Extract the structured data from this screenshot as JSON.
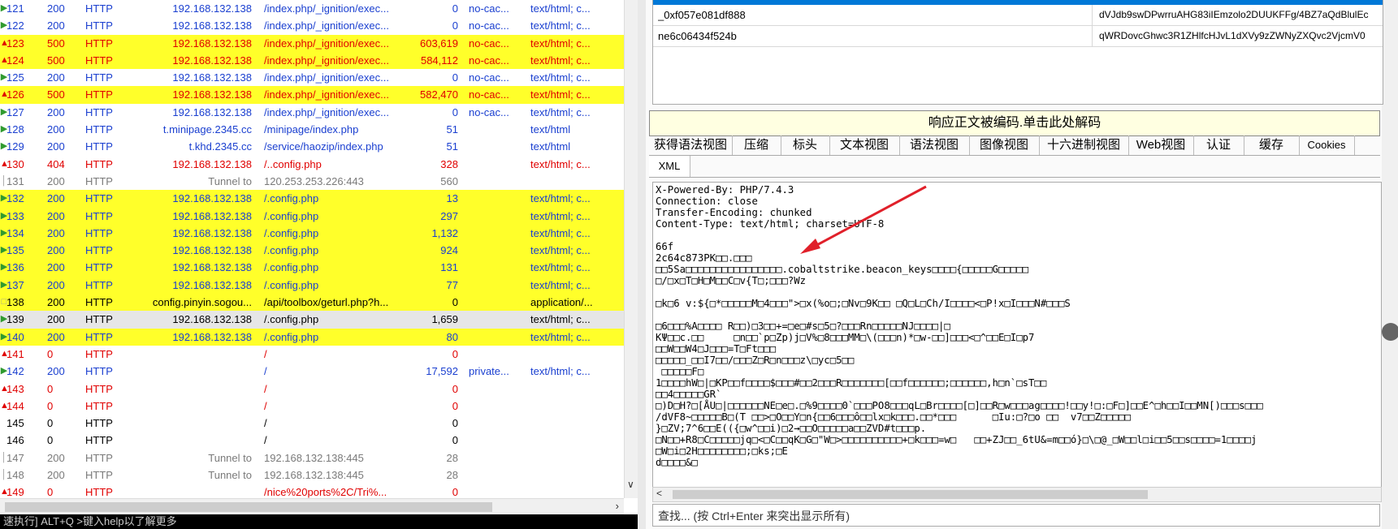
{
  "sessions": [
    {
      "num": "121",
      "result": "200",
      "protocol": "HTTP",
      "host": "192.168.132.138",
      "url": "/index.php/_ignition/exec...",
      "body": "0",
      "caching": "no-cac...",
      "ctype": "text/html; c...",
      "icon": "ok",
      "style": "ok",
      "bg": ""
    },
    {
      "num": "122",
      "result": "200",
      "protocol": "HTTP",
      "host": "192.168.132.138",
      "url": "/index.php/_ignition/exec...",
      "body": "0",
      "caching": "no-cac...",
      "ctype": "text/html; c...",
      "icon": "ok",
      "style": "ok",
      "bg": ""
    },
    {
      "num": "123",
      "result": "500",
      "protocol": "HTTP",
      "host": "192.168.132.138",
      "url": "/index.php/_ignition/exec...",
      "body": "603,619",
      "caching": "no-cac...",
      "ctype": "text/html; c...",
      "icon": "err",
      "style": "err",
      "bg": "yellow"
    },
    {
      "num": "124",
      "result": "500",
      "protocol": "HTTP",
      "host": "192.168.132.138",
      "url": "/index.php/_ignition/exec...",
      "body": "584,112",
      "caching": "no-cac...",
      "ctype": "text/html; c...",
      "icon": "err",
      "style": "err",
      "bg": "yellow"
    },
    {
      "num": "125",
      "result": "200",
      "protocol": "HTTP",
      "host": "192.168.132.138",
      "url": "/index.php/_ignition/exec...",
      "body": "0",
      "caching": "no-cac...",
      "ctype": "text/html; c...",
      "icon": "ok",
      "style": "ok",
      "bg": ""
    },
    {
      "num": "126",
      "result": "500",
      "protocol": "HTTP",
      "host": "192.168.132.138",
      "url": "/index.php/_ignition/exec...",
      "body": "582,470",
      "caching": "no-cac...",
      "ctype": "text/html; c...",
      "icon": "err",
      "style": "err",
      "bg": "yellow"
    },
    {
      "num": "127",
      "result": "200",
      "protocol": "HTTP",
      "host": "192.168.132.138",
      "url": "/index.php/_ignition/exec...",
      "body": "0",
      "caching": "no-cac...",
      "ctype": "text/html; c...",
      "icon": "ok",
      "style": "ok",
      "bg": ""
    },
    {
      "num": "128",
      "result": "200",
      "protocol": "HTTP",
      "host": "t.minipage.2345.cc",
      "url": "/minipage/index.php",
      "body": "51",
      "caching": "",
      "ctype": "text/html",
      "icon": "ok",
      "style": "ok",
      "bg": ""
    },
    {
      "num": "129",
      "result": "200",
      "protocol": "HTTP",
      "host": "t.khd.2345.cc",
      "url": "/service/haozip/index.php",
      "body": "51",
      "caching": "",
      "ctype": "text/html",
      "icon": "ok",
      "style": "ok",
      "bg": ""
    },
    {
      "num": "130",
      "result": "404",
      "protocol": "HTTP",
      "host": "192.168.132.138",
      "url": "/..config.php",
      "body": "328",
      "caching": "",
      "ctype": "text/html; c...",
      "icon": "err",
      "style": "err",
      "bg": ""
    },
    {
      "num": "131",
      "result": "200",
      "protocol": "HTTP",
      "host": "Tunnel to",
      "url": "120.253.253.226:443",
      "body": "560",
      "caching": "",
      "ctype": "",
      "icon": "gray",
      "style": "gray",
      "bg": ""
    },
    {
      "num": "132",
      "result": "200",
      "protocol": "HTTP",
      "host": "192.168.132.138",
      "url": "/.config.php",
      "body": "13",
      "caching": "",
      "ctype": "text/html; c...",
      "icon": "ok",
      "style": "ok",
      "bg": "yellow"
    },
    {
      "num": "133",
      "result": "200",
      "protocol": "HTTP",
      "host": "192.168.132.138",
      "url": "/.config.php",
      "body": "297",
      "caching": "",
      "ctype": "text/html; c...",
      "icon": "ok",
      "style": "ok",
      "bg": "yellow"
    },
    {
      "num": "134",
      "result": "200",
      "protocol": "HTTP",
      "host": "192.168.132.138",
      "url": "/.config.php",
      "body": "1,132",
      "caching": "",
      "ctype": "text/html; c...",
      "icon": "ok",
      "style": "ok",
      "bg": "yellow"
    },
    {
      "num": "135",
      "result": "200",
      "protocol": "HTTP",
      "host": "192.168.132.138",
      "url": "/.config.php",
      "body": "924",
      "caching": "",
      "ctype": "text/html; c...",
      "icon": "ok",
      "style": "ok",
      "bg": "yellow"
    },
    {
      "num": "136",
      "result": "200",
      "protocol": "HTTP",
      "host": "192.168.132.138",
      "url": "/.config.php",
      "body": "131",
      "caching": "",
      "ctype": "text/html; c...",
      "icon": "ok",
      "style": "ok",
      "bg": "yellow"
    },
    {
      "num": "137",
      "result": "200",
      "protocol": "HTTP",
      "host": "192.168.132.138",
      "url": "/.config.php",
      "body": "77",
      "caching": "",
      "ctype": "text/html; c...",
      "icon": "ok",
      "style": "ok",
      "bg": "yellow"
    },
    {
      "num": "138",
      "result": "200",
      "protocol": "HTTP",
      "host": "config.pinyin.sogou...",
      "url": "/api/toolbox/geturl.php?h...",
      "body": "0",
      "caching": "",
      "ctype": "application/...",
      "icon": "doc",
      "style": "black",
      "bg": "yellow"
    },
    {
      "num": "139",
      "result": "200",
      "protocol": "HTTP",
      "host": "192.168.132.138",
      "url": "/.config.php",
      "body": "1,659",
      "caching": "",
      "ctype": "text/html; c...",
      "icon": "ok",
      "style": "black",
      "bg": "sel"
    },
    {
      "num": "140",
      "result": "200",
      "protocol": "HTTP",
      "host": "192.168.132.138",
      "url": "/.config.php",
      "body": "80",
      "caching": "",
      "ctype": "text/html; c...",
      "icon": "ok",
      "style": "ok",
      "bg": "yellow"
    },
    {
      "num": "141",
      "result": "0",
      "protocol": "HTTP",
      "host": "",
      "url": "/",
      "body": "0",
      "caching": "",
      "ctype": "",
      "icon": "err",
      "style": "err",
      "bg": ""
    },
    {
      "num": "142",
      "result": "200",
      "protocol": "HTTP",
      "host": "",
      "url": "/",
      "body": "17,592",
      "caching": "private...",
      "ctype": "text/html; c...",
      "icon": "ok",
      "style": "ok",
      "bg": ""
    },
    {
      "num": "143",
      "result": "0",
      "protocol": "HTTP",
      "host": "",
      "url": "/",
      "body": "0",
      "caching": "",
      "ctype": "",
      "icon": "err",
      "style": "err",
      "bg": ""
    },
    {
      "num": "144",
      "result": "0",
      "protocol": "HTTP",
      "host": "",
      "url": "/",
      "body": "0",
      "caching": "",
      "ctype": "",
      "icon": "err",
      "style": "err",
      "bg": ""
    },
    {
      "num": "145",
      "result": "0",
      "protocol": "HTTP",
      "host": "",
      "url": "/",
      "body": "0",
      "caching": "",
      "ctype": "",
      "icon": "none",
      "style": "black",
      "bg": ""
    },
    {
      "num": "146",
      "result": "0",
      "protocol": "HTTP",
      "host": "",
      "url": "/",
      "body": "0",
      "caching": "",
      "ctype": "",
      "icon": "none",
      "style": "black",
      "bg": ""
    },
    {
      "num": "147",
      "result": "200",
      "protocol": "HTTP",
      "host": "Tunnel to",
      "url": "192.168.132.138:445",
      "body": "28",
      "caching": "",
      "ctype": "",
      "icon": "gray",
      "style": "gray",
      "bg": ""
    },
    {
      "num": "148",
      "result": "200",
      "protocol": "HTTP",
      "host": "Tunnel to",
      "url": "192.168.132.138:445",
      "body": "28",
      "caching": "",
      "ctype": "",
      "icon": "gray",
      "style": "gray",
      "bg": ""
    },
    {
      "num": "149",
      "result": "0",
      "protocol": "HTTP",
      "host": "",
      "url": "/nice%20ports%2C/Tri%...",
      "body": "0",
      "caching": "",
      "ctype": "",
      "icon": "err",
      "style": "err",
      "bg": ""
    }
  ],
  "status_bar": "速执行] ALT+Q >键入help以了解更多",
  "cookies": [
    {
      "name": "_0xf057e081df888",
      "value": "dVJdb9swDPwrruAHG83iIEmzolo2DUUKFFg/4BZ7aQdBlulEc"
    },
    {
      "name": "ne6c06434f524b",
      "value": "qWRDovcGhwc3R1ZHlfcHJvL1dXVy9zZWNyZXQvc2VjcmV0"
    }
  ],
  "decode_bar": "响应正文被编码.单击此处解码",
  "tabs_row1": [
    "获得语法视图",
    "压缩",
    "标头",
    "文本视图",
    "语法视图",
    "图像视图",
    "十六进制视图",
    "Web视图",
    "认证",
    "缓存",
    "Cookies"
  ],
  "tabs_row2": [
    "XML"
  ],
  "response_text": "X-Powered-By: PHP/7.4.3\nConnection: close\nTransfer-Encoding: chunked\nContent-Type: text/html; charset=UTF-8\n\n66f\n2c64c873PK□□.□□□\n□□5Sa□□□□□□□□□□□□□□□□.cobaltstrike.beacon_keys□□□□{□□□□□G□□□□□\n□/□x□T□H□M□□C□v{T□;□□□?Wz\n\n□k□6 v:${□*□□□□□M□4□□□\">□x(%o□;□Nv□9K□□ □Q□L□Ch/I□□□□<□P!x□I□□□N#□□□S\n\n□6□□□%A□□□□ R□□)□3□□+=□e□#s□5□?□□□Rn□□□□□NJ□□□□|□\nKΨ□□c.□□     □n□□`p□Zp)j□V%□8□□□MM□\\(□□□n)*□w-□□]□□□<□^□□E□I□p7\n□□W□□W4□J□□□=T□Ft□□□\n□□□□□_□□I7□□/□□□Z□R□n□□□z\\□yc□5□□\n □□□□□F□\n1□□□□hW□|□KP□□f□□□□$□□□#□□2□□□R□□□□□□□[□□f□□□□□□;□□□□□□,h□n`□sT□□\n□□4□□□□□GR`\n□)D□H?□[ÅU□|□□□□□□NE□e□.□%9□□□□0`□□□PO8□□□qL□Br□□□□[□]□□R□w□□□ag□□□□!□□y!□:□F□]□□E^□h□□I□□MN[)□□□s□□□\n/dVF8~□□□□□B□(T □□>□O□□Y□n{□□6□□□ô□□lx□k□□□.□□*□□□      □Iu:□?□o □□  v7□□Z□□□□□\n}□ZV;7^6□□E(({□w^□□i)□2→□□O□□□□□a□□ZVD#t□□□p.\n□N□□+R8□C□□□□□jq□<□C□□qK□G□\"W□>□□□□□□□□□□+□k□□□=w□   □□+ZJ□□_6tU&=m□□ó}□\\□@_□W□□l□i□□5□□s□□□□=1□□□□j\n□W□i□2H□□□□□□□□;□ks;□E\nd□□□□&□",
  "find_placeholder": "查找... (按 Ctrl+Enter 来突出显示所有)",
  "colors": {
    "highlight": "#ffff2a",
    "error": "#e00000",
    "ok": "#1a3fd0",
    "arrow": "#e0202a"
  }
}
